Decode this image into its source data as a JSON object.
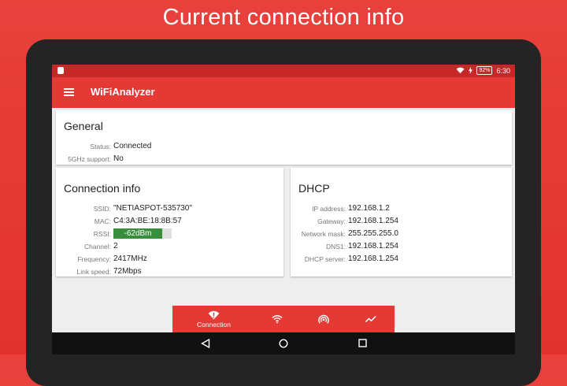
{
  "headline": "Current connection info",
  "status_bar": {
    "battery": "92%",
    "time": "6:30"
  },
  "app_bar": {
    "title": "WiFiAnalyzer"
  },
  "general": {
    "title": "General",
    "rows": [
      {
        "label": "Status:",
        "value": "Connected"
      },
      {
        "label": "5GHz support:",
        "value": "No"
      }
    ]
  },
  "connection": {
    "title": "Connection info",
    "ssid_label": "SSID:",
    "ssid": "\"NETIASPOT-535730\"",
    "mac_label": "MAC:",
    "mac": "C4:3A:BE:18:8B:57",
    "rssi_label": "RSSI:",
    "rssi": "-62dBm",
    "rssi_fill_fraction": 0.84,
    "rssi_color": "#388e3c",
    "channel_label": "Channel:",
    "channel": "2",
    "frequency_label": "Frequency:",
    "frequency": "2417MHz",
    "link_label": "Link speed:",
    "link_speed": "72Mbps"
  },
  "dhcp": {
    "title": "DHCP",
    "rows": [
      {
        "label": "IP address:",
        "value": "192.168.1.2"
      },
      {
        "label": "Gateway:",
        "value": "192.168.1.254"
      },
      {
        "label": "Network mask:",
        "value": "255.255.255.0"
      },
      {
        "label": "DNS1:",
        "value": "192.168.1.254"
      },
      {
        "label": "DHCP server:",
        "value": "192.168.1.254"
      }
    ]
  },
  "bottom_nav": {
    "items": [
      {
        "icon": "wifi-info-icon",
        "label": "Connection",
        "active": true
      },
      {
        "icon": "wifi-icon",
        "label": ""
      },
      {
        "icon": "access-point-icon",
        "label": ""
      },
      {
        "icon": "graph-icon",
        "label": ""
      }
    ]
  },
  "colors": {
    "primary": "#e53935",
    "primary_dark": "#c62828",
    "background": "#eeeeee",
    "signal_good": "#388e3c"
  }
}
